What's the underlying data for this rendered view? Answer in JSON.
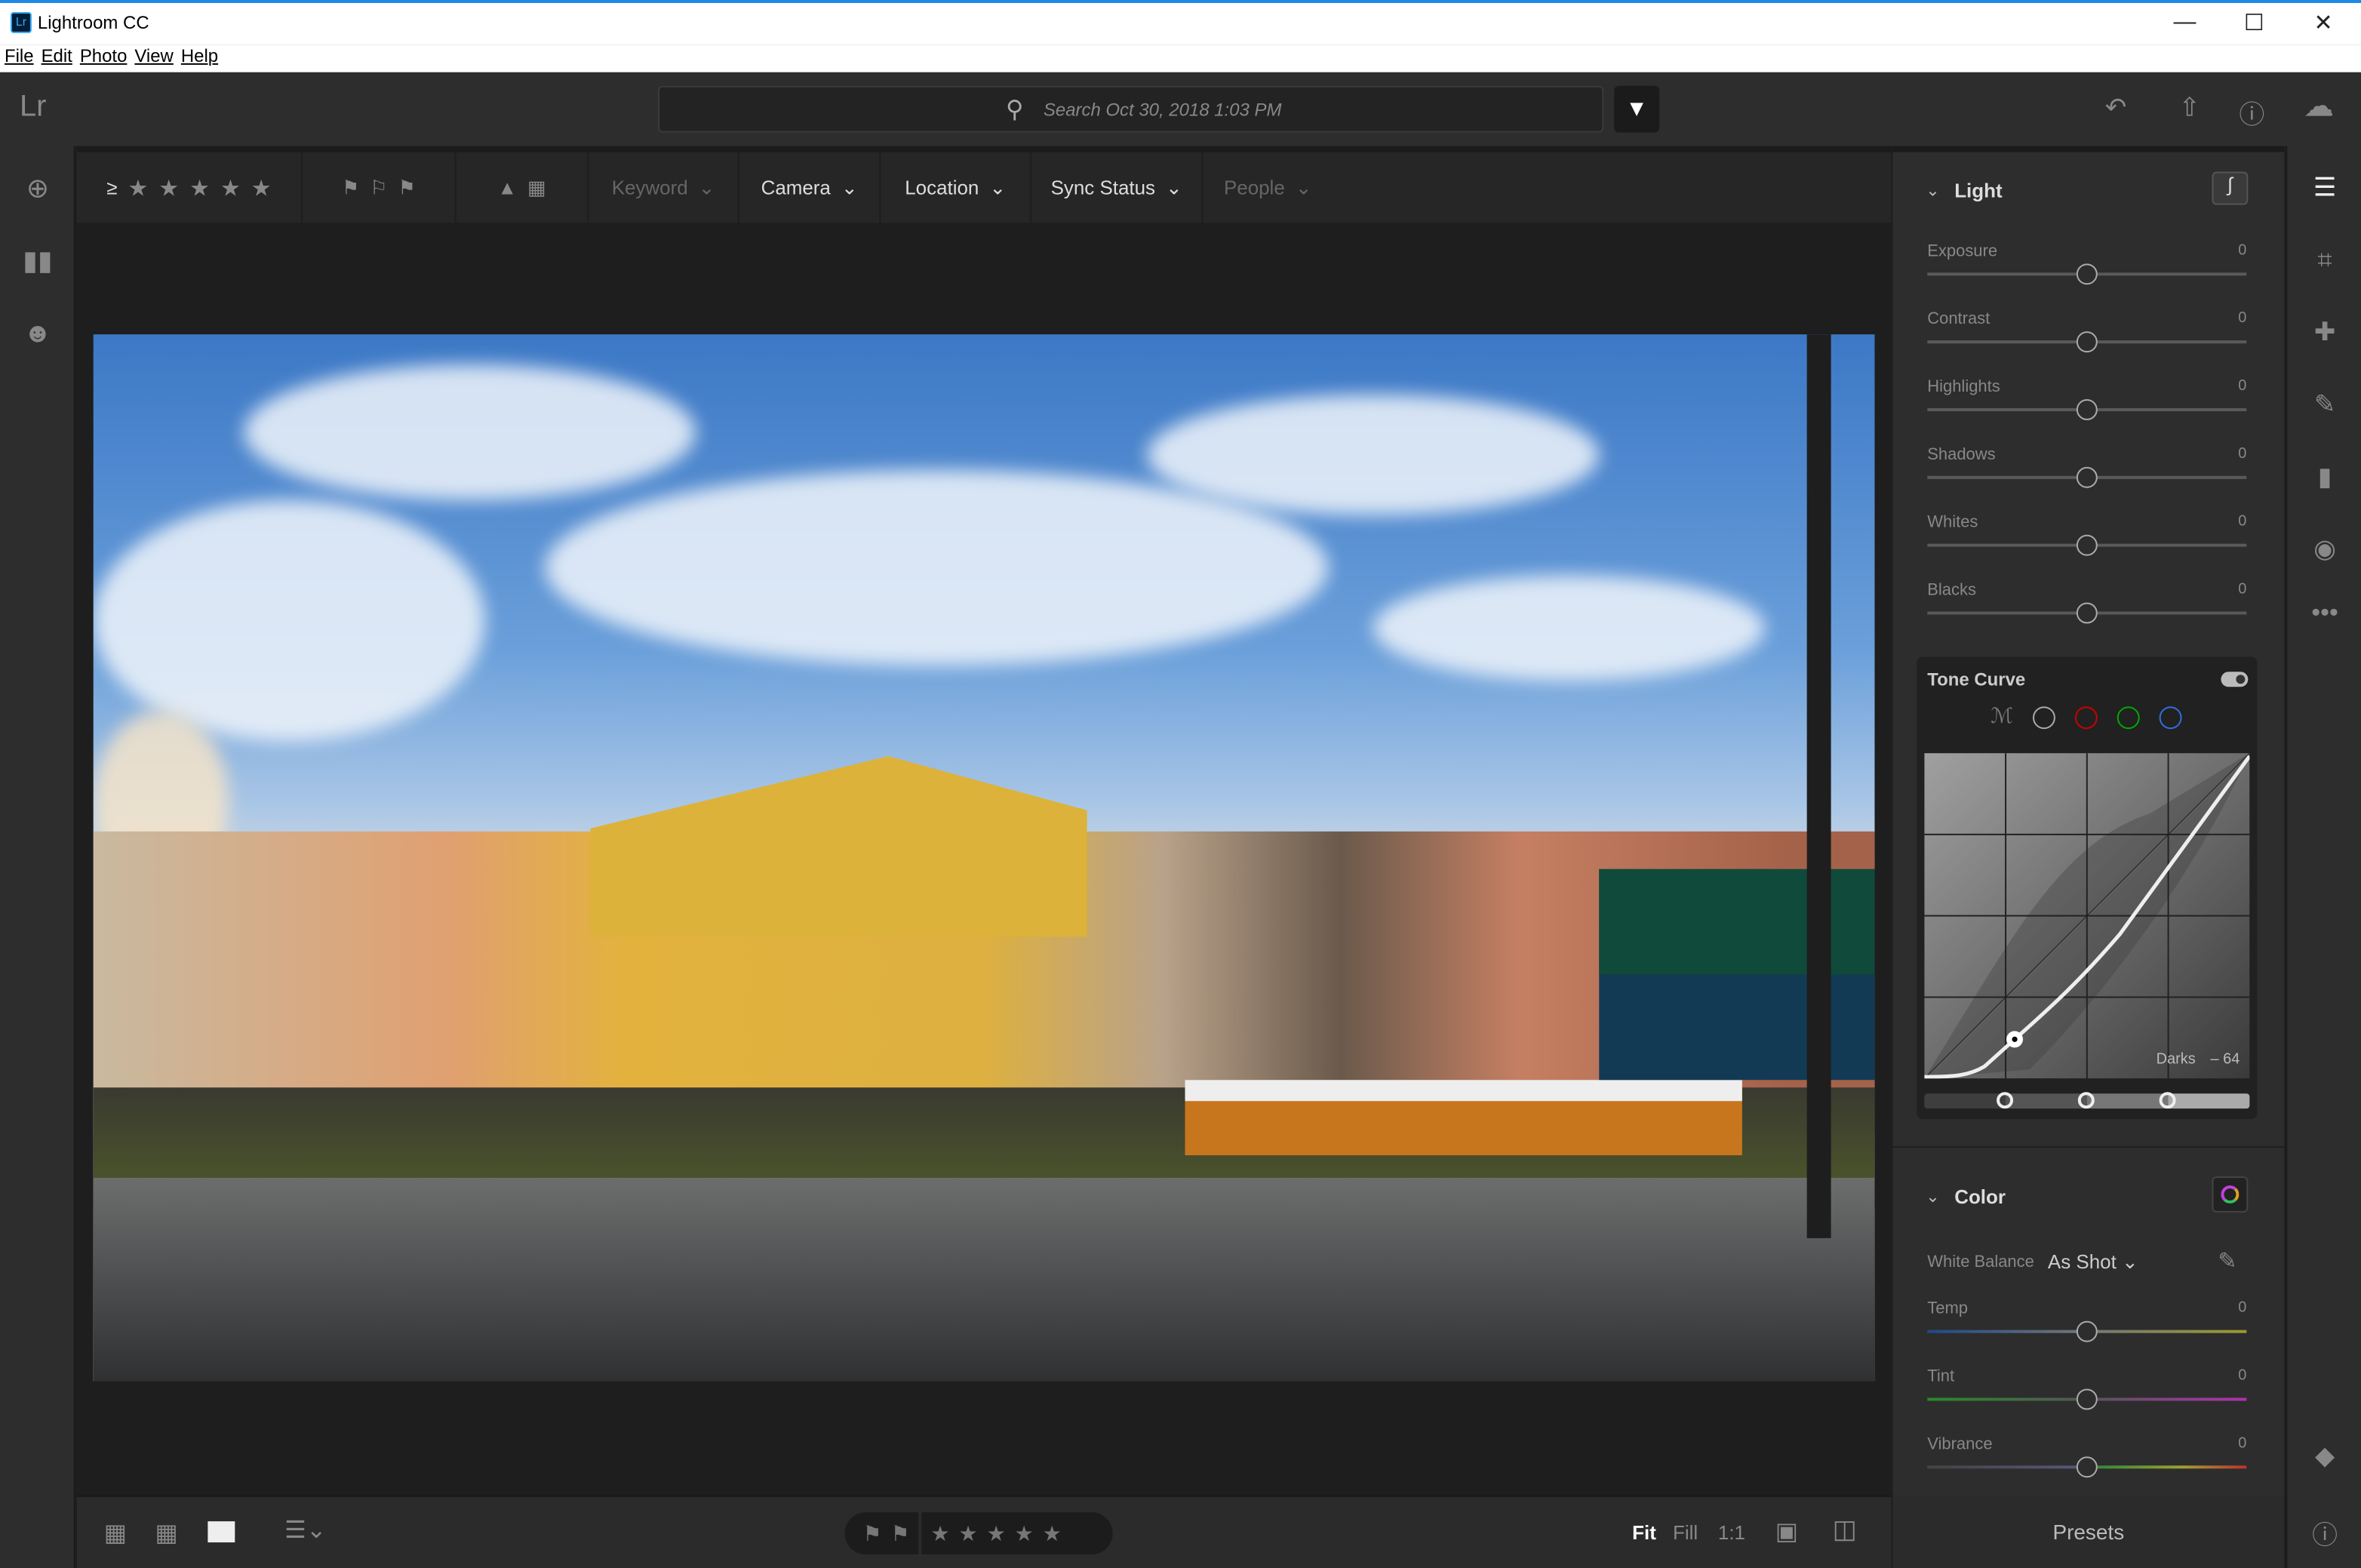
{
  "window": {
    "title": "Lightroom CC",
    "logo": "Lr",
    "minimize": "—",
    "maximize": "☐",
    "close": "✕"
  },
  "menu": [
    "File",
    "Edit",
    "Photo",
    "View",
    "Help"
  ],
  "topbar": {
    "app_logo": "Lr",
    "search_placeholder": "Search Oct 30, 2018 1:03 PM"
  },
  "filterbar": {
    "rating_op": "≥",
    "stars": 5,
    "keyword": "Keyword",
    "camera": "Camera",
    "location": "Location",
    "sync_status": "Sync Status",
    "people": "People"
  },
  "light": {
    "title": "Light",
    "sliders": [
      {
        "label": "Exposure",
        "value": "0"
      },
      {
        "label": "Contrast",
        "value": "0"
      },
      {
        "label": "Highlights",
        "value": "0"
      },
      {
        "label": "Shadows",
        "value": "0"
      },
      {
        "label": "Whites",
        "value": "0"
      },
      {
        "label": "Blacks",
        "value": "0"
      }
    ]
  },
  "tone_curve": {
    "title": "Tone Curve",
    "enabled": true,
    "channel_colors": [
      "#aaaaaa",
      "#cc0000",
      "#00aa00",
      "#2f6fe0"
    ],
    "readout_label": "Darks",
    "readout_value": "– 64"
  },
  "color": {
    "title": "Color",
    "white_balance_label": "White Balance",
    "white_balance_value": "As Shot",
    "sliders": [
      {
        "label": "Temp",
        "value": "0"
      },
      {
        "label": "Tint",
        "value": "0"
      },
      {
        "label": "Vibrance",
        "value": "0"
      }
    ]
  },
  "bottombar": {
    "fit": "Fit",
    "fill": "Fill",
    "one_to_one": "1:1"
  },
  "presets": "Presets"
}
